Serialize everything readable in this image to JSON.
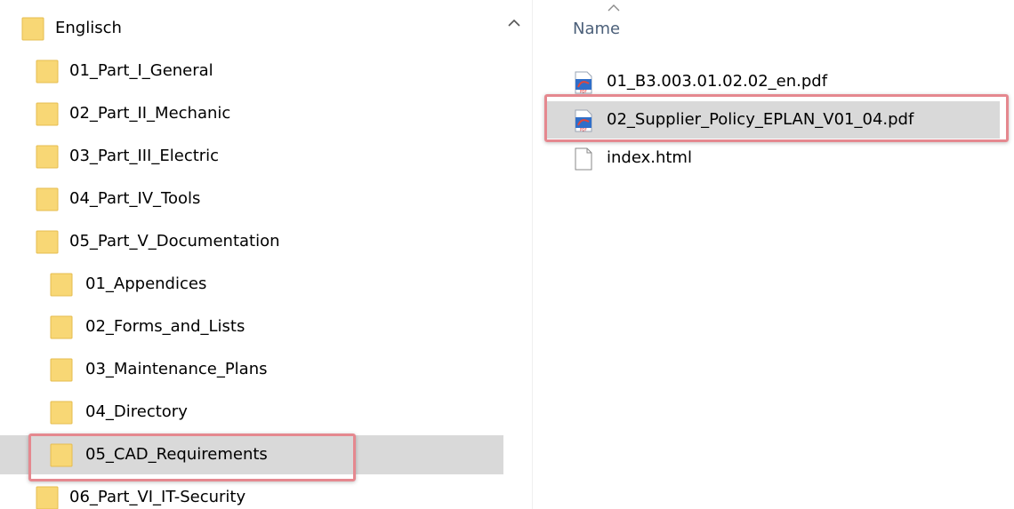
{
  "nav_tree": {
    "items": [
      {
        "label": "Englisch"
      },
      {
        "label": "01_Part_I_General"
      },
      {
        "label": "02_Part_II_Mechanic"
      },
      {
        "label": "03_Part_III_Electric"
      },
      {
        "label": "04_Part_IV_Tools"
      },
      {
        "label": "05_Part_V_Documentation"
      },
      {
        "label": "01_Appendices"
      },
      {
        "label": "02_Forms_and_Lists"
      },
      {
        "label": "03_Maintenance_Plans"
      },
      {
        "label": "04_Directory"
      },
      {
        "label": "05_CAD_Requirements",
        "selected": true
      },
      {
        "label": "06_Part_VI_IT-Security"
      }
    ]
  },
  "file_list": {
    "column_header": "Name",
    "sort_direction": "ascending",
    "files": [
      {
        "name": "01_B3.003.01.02.02_en.pdf",
        "icon": "pdf-icon"
      },
      {
        "name": "02_Supplier_Policy_EPLAN_V01_04.pdf",
        "icon": "pdf-icon",
        "selected": true
      },
      {
        "name": "index.html",
        "icon": "html-file-icon"
      }
    ]
  },
  "colors": {
    "selection": "#d9d9d9",
    "highlight_border": "#e5888f",
    "folder_yellow": "#f8d775",
    "header_text": "#4c607a"
  }
}
